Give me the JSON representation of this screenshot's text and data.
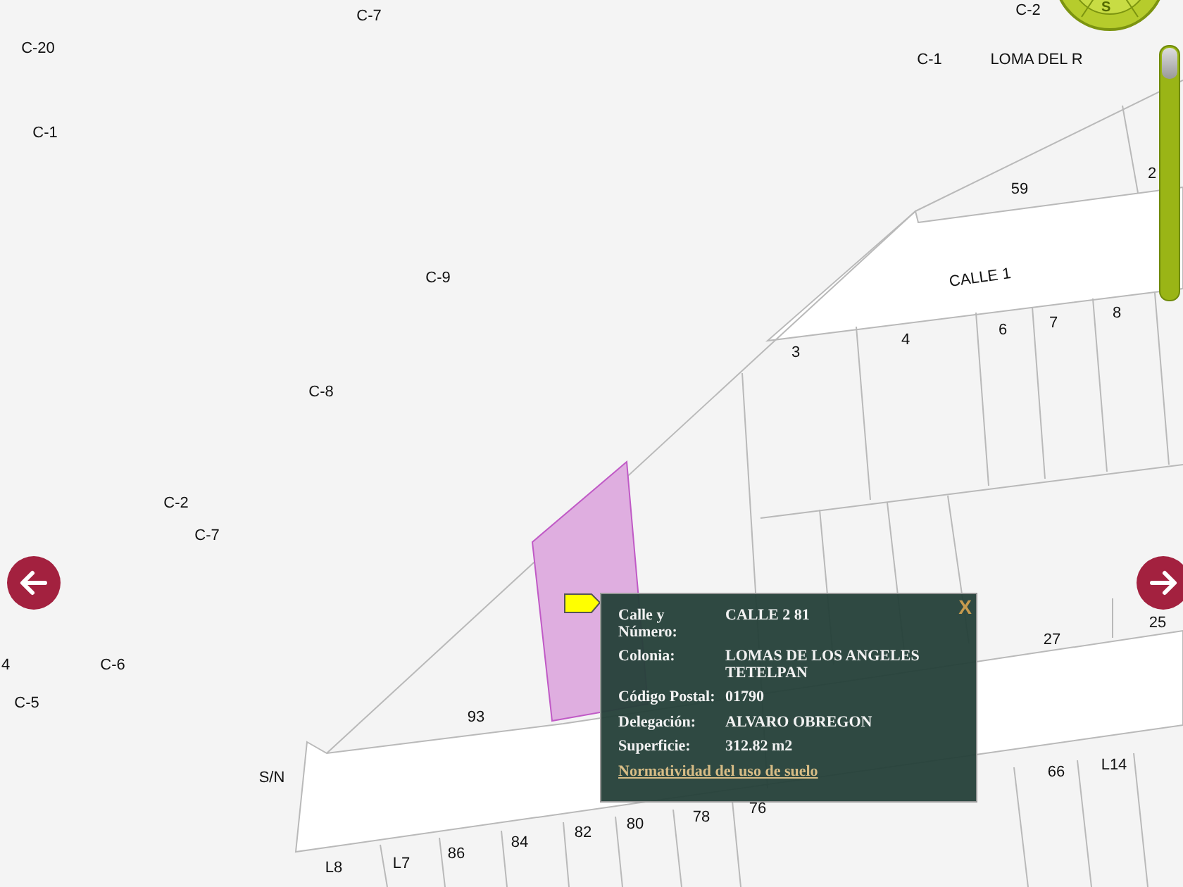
{
  "map_labels": [
    {
      "text": "C-7"
    },
    {
      "text": "C-2"
    },
    {
      "text": "C-20"
    },
    {
      "text": "C-1"
    },
    {
      "text": "LOMA DEL R"
    },
    {
      "text": "C-1"
    },
    {
      "text": "59"
    },
    {
      "text": "2"
    },
    {
      "text": "C-9"
    },
    {
      "text": "CALLE 1"
    },
    {
      "text": "3"
    },
    {
      "text": "4"
    },
    {
      "text": "6"
    },
    {
      "text": "7"
    },
    {
      "text": "8"
    },
    {
      "text": "C-8"
    },
    {
      "text": "C-2"
    },
    {
      "text": "C-7"
    },
    {
      "text": "25"
    },
    {
      "text": "27"
    },
    {
      "text": "4"
    },
    {
      "text": "C-6"
    },
    {
      "text": "C-5"
    },
    {
      "text": "93"
    },
    {
      "text": "S/N"
    },
    {
      "text": "66"
    },
    {
      "text": "L14"
    },
    {
      "text": "76"
    },
    {
      "text": "78"
    },
    {
      "text": "80"
    },
    {
      "text": "82"
    },
    {
      "text": "84"
    },
    {
      "text": "86"
    },
    {
      "text": "L7"
    },
    {
      "text": "L8"
    }
  ],
  "compass": {
    "label": "S"
  },
  "zoom_slider": {
    "level": 1
  },
  "popup": {
    "close": "X",
    "fields": [
      {
        "label": "Calle y Número:",
        "value": "CALLE 2 81"
      },
      {
        "label": "Colonia:",
        "value": "LOMAS DE LOS ANGELES TETELPAN"
      },
      {
        "label": "Código Postal:",
        "value": "01790"
      },
      {
        "label": "Delegación:",
        "value": "ALVARO OBREGON"
      },
      {
        "label": "Superficie:",
        "value": "312.82 m2"
      }
    ],
    "link": "Normatividad del uso de suelo"
  }
}
